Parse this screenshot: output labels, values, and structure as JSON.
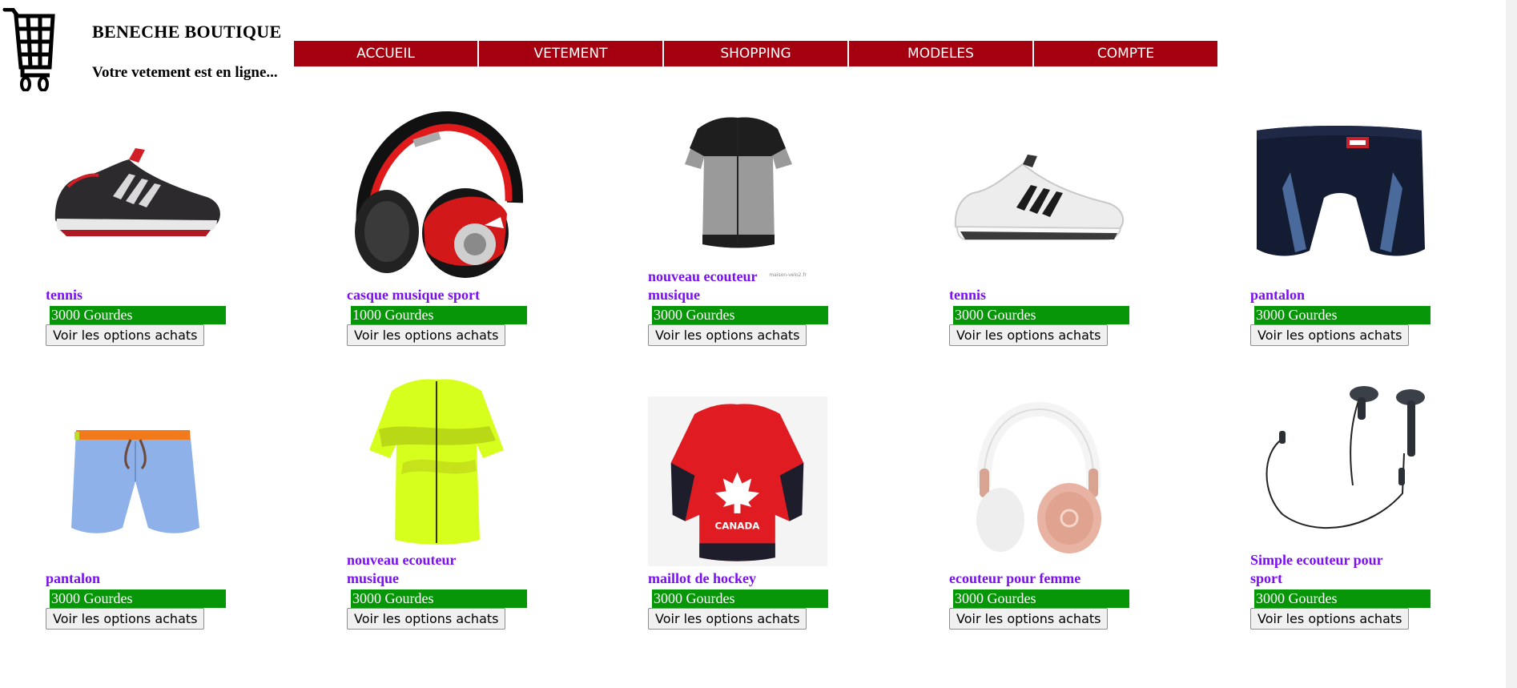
{
  "header": {
    "brand_title": "BENECHE BOUTIQUE",
    "tagline": "Votre vetement est en ligne..."
  },
  "nav": {
    "items": [
      {
        "label": "ACCUEIL"
      },
      {
        "label": "VETEMENT"
      },
      {
        "label": "SHOPPING"
      },
      {
        "label": "MODELES"
      },
      {
        "label": "COMPTE"
      }
    ]
  },
  "products": [
    {
      "title": "tennis",
      "price": "3000 Gourdes",
      "button": "Voir les options achats",
      "image": "black-sneaker"
    },
    {
      "title": "casque musique sport",
      "price": "1000 Gourdes",
      "button": "Voir les options achats",
      "image": "red-headphones"
    },
    {
      "title": "nouveau ecouteur musique",
      "price": "3000 Gourdes",
      "button": "Voir les options achats",
      "image": "grey-cycling-jersey",
      "watermark": "maison-velo2.fr"
    },
    {
      "title": "tennis",
      "price": "3000 Gourdes",
      "button": "Voir les options achats",
      "image": "white-sneaker"
    },
    {
      "title": "pantalon",
      "price": "3000 Gourdes",
      "button": "Voir les options achats",
      "image": "navy-swim-trunks"
    },
    {
      "title": "pantalon",
      "price": "3000 Gourdes",
      "button": "Voir les options achats",
      "image": "blue-swim-shorts"
    },
    {
      "title": "nouveau ecouteur musique",
      "price": "3000 Gourdes",
      "button": "Voir les options achats",
      "image": "yellow-cycling-jersey"
    },
    {
      "title": "maillot de hockey",
      "price": "3000 Gourdes",
      "button": "Voir les options achats",
      "image": "red-hockey-jersey",
      "jersey_text": "CANADA"
    },
    {
      "title": "ecouteur pour femme",
      "price": "3000 Gourdes",
      "button": "Voir les options achats",
      "image": "rose-gold-headphones"
    },
    {
      "title": "Simple ecouteur pour sport",
      "price": "3000 Gourdes",
      "button": "Voir les options achats",
      "image": "black-earphones"
    }
  ],
  "colors": {
    "nav_bg": "#a5000f",
    "price_bg": "#079607",
    "title_color": "#7a0ff0"
  }
}
